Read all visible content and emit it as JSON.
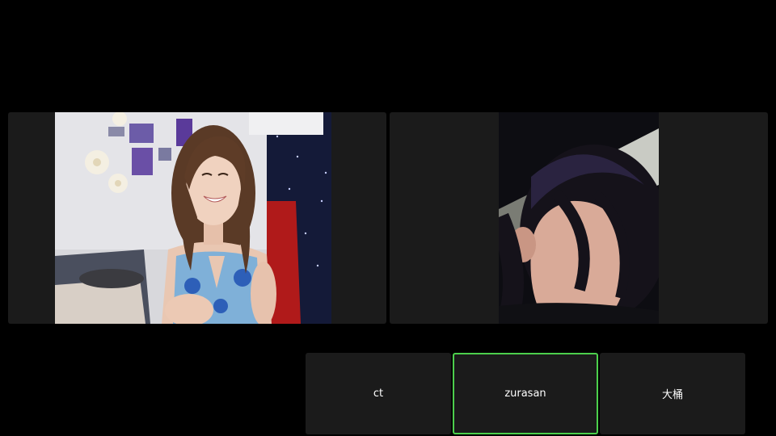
{
  "video_grid": {
    "tiles": [
      {
        "id": "left",
        "content": "webcam-feed",
        "active": false
      },
      {
        "id": "right",
        "content": "webcam-feed",
        "active": false
      }
    ]
  },
  "participants": [
    {
      "name": "ct",
      "active": false
    },
    {
      "name": "zurasan",
      "active": true
    },
    {
      "name": "大桶",
      "active": false
    }
  ],
  "colors": {
    "background": "#000000",
    "tile": "#1b1b1b",
    "active_border": "#4ccf4c",
    "name_text": "#ffffff"
  }
}
